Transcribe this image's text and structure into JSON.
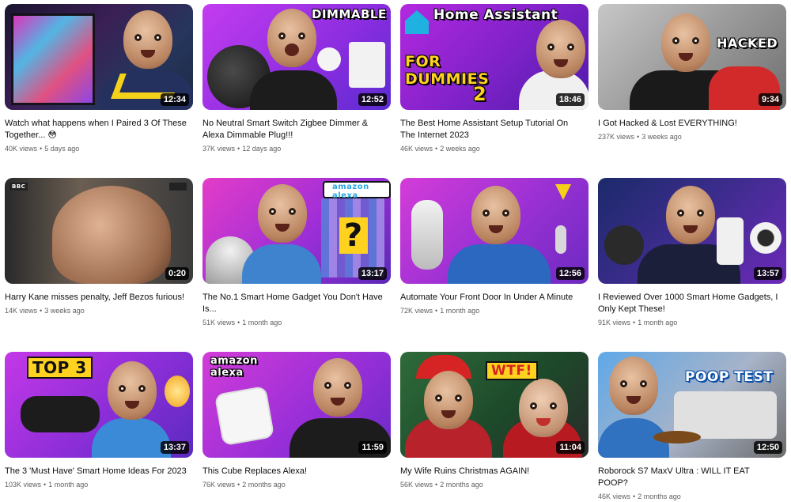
{
  "videos": [
    {
      "title": "Watch what happens when I Paired 3 Of These Together... 😳",
      "views": "40K views",
      "age": "5 days ago",
      "duration": "12:34",
      "thumb_text": ""
    },
    {
      "title": "No Neutral Smart Switch Zigbee Dimmer & Alexa Dimmable Plug!!!",
      "views": "37K views",
      "age": "12 days ago",
      "duration": "12:52",
      "thumb_text": "DIMMABLE"
    },
    {
      "title": "The Best Home Assistant Setup Tutorial On The Internet 2023",
      "views": "46K views",
      "age": "2 weeks ago",
      "duration": "18:46",
      "thumb_text": "Home Assistant",
      "thumb_text2": "FOR DUMMIES",
      "thumb_text3": "2"
    },
    {
      "title": "I Got Hacked & Lost EVERYTHING!",
      "views": "237K views",
      "age": "3 weeks ago",
      "duration": "9:34",
      "thumb_text": "HACKED"
    },
    {
      "title": "Harry Kane misses penalty, Jeff Bezos furious!",
      "views": "14K views",
      "age": "3 weeks ago",
      "duration": "0:20",
      "thumb_text": "BBC"
    },
    {
      "title": "The No.1 Smart Home Gadget You Don't Have Is...",
      "views": "51K views",
      "age": "1 month ago",
      "duration": "13:17",
      "thumb_text": "amazon alexa",
      "thumb_text2": "?"
    },
    {
      "title": "Automate Your Front Door In Under A Minute",
      "views": "72K views",
      "age": "1 month ago",
      "duration": "12:56",
      "thumb_text": ""
    },
    {
      "title": "I Reviewed Over 1000 Smart Home Gadgets, I Only Kept These!",
      "views": "91K views",
      "age": "1 month ago",
      "duration": "13:57",
      "thumb_text": ""
    },
    {
      "title": "The 3 'Must Have' Smart Home Ideas For 2023",
      "views": "103K views",
      "age": "1 month ago",
      "duration": "13:37",
      "thumb_text": "TOP 3"
    },
    {
      "title": "This Cube Replaces Alexa!",
      "views": "76K views",
      "age": "2 months ago",
      "duration": "11:59",
      "thumb_text": "amazon alexa"
    },
    {
      "title": "My Wife Ruins Christmas AGAIN!",
      "views": "56K views",
      "age": "2 months ago",
      "duration": "11:04",
      "thumb_text": "WTF!"
    },
    {
      "title": "Roborock S7 MaxV Ultra : WILL IT EAT POOP?",
      "views": "46K views",
      "age": "2 months ago",
      "duration": "12:50",
      "thumb_text": "POOP TEST"
    }
  ],
  "colors": {
    "meta_text": "#606060",
    "title_text": "#0f0f0f",
    "duration_bg": "#000000"
  }
}
